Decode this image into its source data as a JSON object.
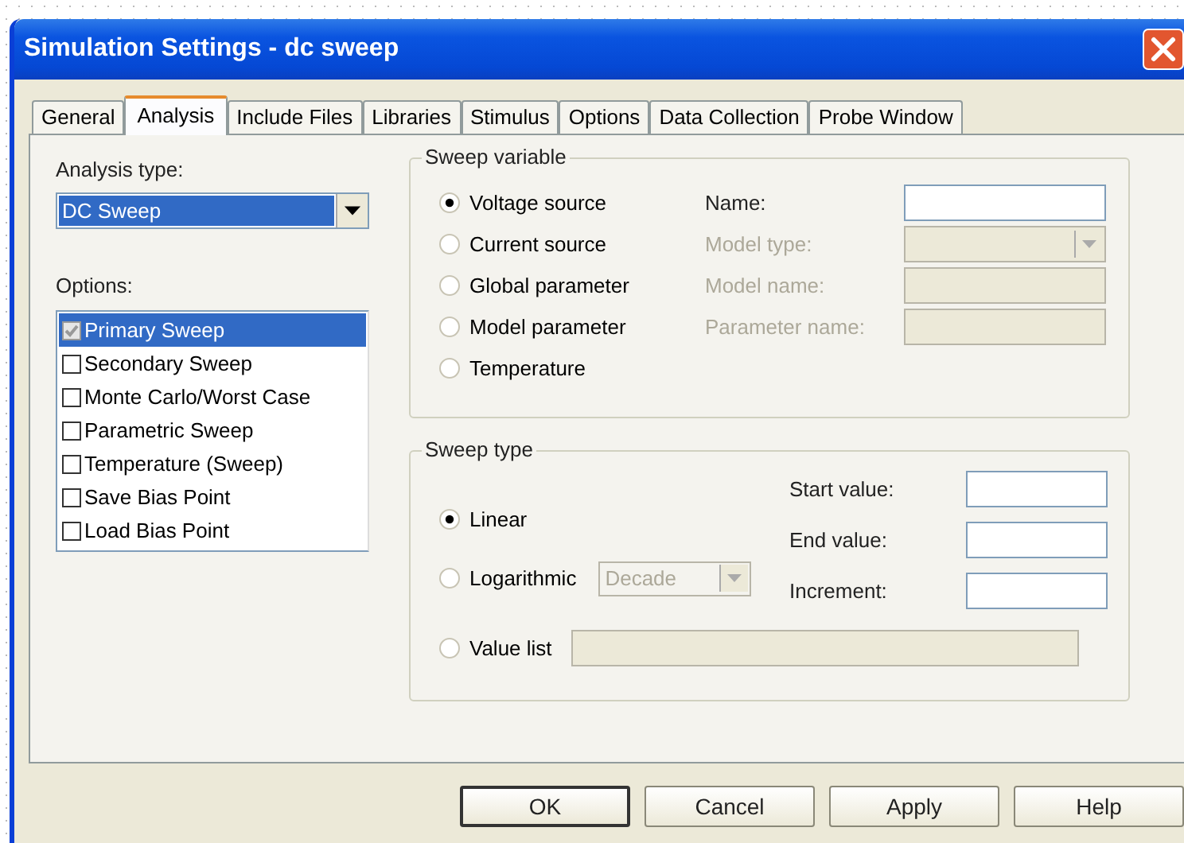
{
  "window": {
    "title": "Simulation Settings - dc sweep"
  },
  "tabs": [
    {
      "label": "General",
      "selected": false
    },
    {
      "label": "Analysis",
      "selected": true
    },
    {
      "label": "Include Files",
      "selected": false
    },
    {
      "label": "Libraries",
      "selected": false
    },
    {
      "label": "Stimulus",
      "selected": false
    },
    {
      "label": "Options",
      "selected": false
    },
    {
      "label": "Data Collection",
      "selected": false
    },
    {
      "label": "Probe Window",
      "selected": false
    }
  ],
  "analysis_type": {
    "label": "Analysis type:",
    "value": "DC Sweep"
  },
  "options": {
    "label": "Options:",
    "items": [
      {
        "label": "Primary Sweep",
        "checked": true,
        "disabled": true,
        "selected": true
      },
      {
        "label": "Secondary Sweep",
        "checked": false,
        "disabled": false,
        "selected": false
      },
      {
        "label": "Monte Carlo/Worst Case",
        "checked": false,
        "disabled": false,
        "selected": false
      },
      {
        "label": "Parametric Sweep",
        "checked": false,
        "disabled": false,
        "selected": false
      },
      {
        "label": "Temperature (Sweep)",
        "checked": false,
        "disabled": false,
        "selected": false
      },
      {
        "label": "Save Bias Point",
        "checked": false,
        "disabled": false,
        "selected": false
      },
      {
        "label": "Load Bias Point",
        "checked": false,
        "disabled": false,
        "selected": false
      }
    ]
  },
  "sweep_variable": {
    "title": "Sweep variable",
    "options": [
      {
        "label": "Voltage source",
        "selected": true
      },
      {
        "label": "Current source",
        "selected": false
      },
      {
        "label": "Global parameter",
        "selected": false
      },
      {
        "label": "Model parameter",
        "selected": false
      },
      {
        "label": "Temperature",
        "selected": false
      }
    ],
    "fields": [
      {
        "label": "Name:",
        "kind": "text",
        "disabled": false
      },
      {
        "label": "Model type:",
        "kind": "combo",
        "disabled": true
      },
      {
        "label": "Model name:",
        "kind": "text",
        "disabled": true
      },
      {
        "label": "Parameter name:",
        "kind": "text",
        "disabled": true
      }
    ]
  },
  "sweep_type": {
    "title": "Sweep type",
    "options": [
      {
        "label": "Linear",
        "selected": true,
        "kind": "plain"
      },
      {
        "label": "Logarithmic",
        "selected": false,
        "kind": "combo",
        "combo_value": "Decade",
        "disabled": true
      },
      {
        "label": "Value list",
        "selected": false,
        "kind": "field",
        "disabled": true
      }
    ],
    "fields": [
      {
        "label": "Start value:"
      },
      {
        "label": "End value:"
      },
      {
        "label": "Increment:"
      }
    ]
  },
  "buttons": [
    {
      "label": "OK",
      "default": true
    },
    {
      "label": "Cancel",
      "default": false
    },
    {
      "label": "Apply",
      "default": false
    },
    {
      "label": "Help",
      "default": false
    }
  ]
}
